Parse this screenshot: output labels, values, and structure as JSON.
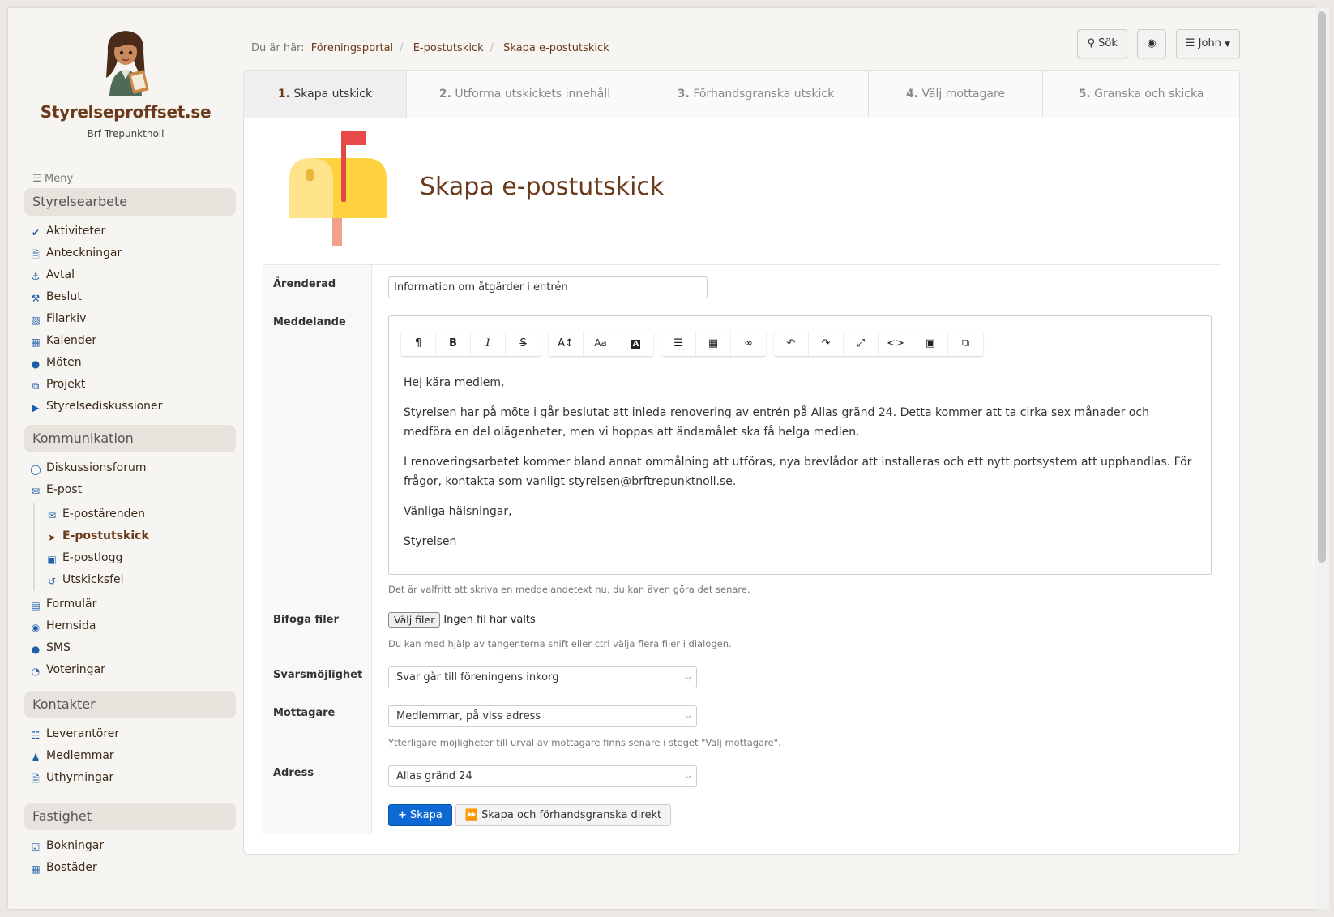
{
  "brand": {
    "name": "Styrelseproffset.se",
    "org": "Brf Trepunktnoll"
  },
  "menu_label": "Meny",
  "sections": [
    {
      "title": "Styrelsearbete",
      "items": [
        {
          "label": "Aktiviteter",
          "icon": "check-icon"
        },
        {
          "label": "Anteckningar",
          "icon": "document-icon"
        },
        {
          "label": "Avtal",
          "icon": "handshake-icon"
        },
        {
          "label": "Beslut",
          "icon": "gavel-icon"
        },
        {
          "label": "Filarkiv",
          "icon": "folder-icon"
        },
        {
          "label": "Kalender",
          "icon": "calendar-icon"
        },
        {
          "label": "Möten",
          "icon": "speech-bubble-icon"
        },
        {
          "label": "Projekt",
          "icon": "copy-icon"
        },
        {
          "label": "Styrelsediskussioner",
          "icon": "megaphone-icon"
        }
      ]
    },
    {
      "title": "Kommunikation",
      "items": [
        {
          "label": "Diskussionsforum",
          "icon": "comments-icon"
        },
        {
          "label": "E-post",
          "icon": "envelope-icon"
        },
        {
          "label": "Formulär",
          "icon": "list-icon"
        },
        {
          "label": "Hemsida",
          "icon": "globe-icon"
        },
        {
          "label": "SMS",
          "icon": "comment-icon"
        },
        {
          "label": "Voteringar",
          "icon": "pie-chart-icon"
        }
      ],
      "subitems": [
        {
          "label": "E-postärenden",
          "icon": "envelope-icon"
        },
        {
          "label": "E-postutskick",
          "icon": "paper-plane-icon"
        },
        {
          "label": "E-postlogg",
          "icon": "inbox-icon"
        },
        {
          "label": "Utskicksfel",
          "icon": "undo-icon"
        }
      ]
    },
    {
      "title": "Kontakter",
      "items": [
        {
          "label": "Leverantörer",
          "icon": "cart-icon"
        },
        {
          "label": "Medlemmar",
          "icon": "user-icon"
        },
        {
          "label": "Uthyrningar",
          "icon": "document-icon"
        }
      ]
    },
    {
      "title": "Fastighet",
      "items": [
        {
          "label": "Bokningar",
          "icon": "checkbox-icon"
        },
        {
          "label": "Bostäder",
          "icon": "building-icon"
        }
      ]
    }
  ],
  "breadcrumb": {
    "prefix": "Du är här:",
    "items": [
      "Föreningsportal",
      "E-postutskick",
      "Skapa e-postutskick"
    ]
  },
  "topbar": {
    "search_label": "Sök",
    "user_label": "John"
  },
  "steps": [
    {
      "num": "1.",
      "label": "Skapa utskick"
    },
    {
      "num": "2.",
      "label": "Utforma utskickets innehåll"
    },
    {
      "num": "3.",
      "label": "Förhandsgranska utskick"
    },
    {
      "num": "4.",
      "label": "Välj mottagare"
    },
    {
      "num": "5.",
      "label": "Granska och skicka"
    }
  ],
  "page_title": "Skapa e-postutskick",
  "form": {
    "subject_label": "Ärenderad",
    "subject_value": "Information om åtgärder i entrén",
    "message_label": "Meddelande",
    "message_paragraphs": [
      "Hej kära medlem,",
      "Styrelsen har på möte i går beslutat att inleda renovering av entrén på Allas gränd 24. Detta kommer att ta cirka sex månader och medföra en del olägenheter, men vi hoppas att ändamålet ska få helga medlen.",
      "I renoveringsarbetet kommer bland annat ommålning att utföras, nya brevlådor att installeras och ett nytt portsystem att upphandlas. För frågor, kontakta som vanligt styrelsen@brftrepunktnoll.se.",
      "Vänliga hälsningar,",
      "Styrelsen"
    ],
    "message_help": "Det är valfritt att skriva en meddelandetext nu, du kan även göra det senare.",
    "attach_label": "Bifoga filer",
    "file_button": "Välj filer",
    "file_status": "Ingen fil har valts",
    "attach_help": "Du kan med hjälp av tangenterna shift eller ctrl välja flera filer i dialogen.",
    "reply_label": "Svarsmöjlighet",
    "reply_value": "Svar går till föreningens inkorg",
    "recipients_label": "Mottagare",
    "recipients_value": "Medlemmar, på viss adress",
    "recipients_help": "Ytterligare möjligheter till urval av mottagare finns senare i steget \"Välj mottagare\".",
    "address_label": "Adress",
    "address_value": "Allas gränd 24",
    "create_button": "Skapa",
    "create_preview_button": "Skapa och förhandsgranska direkt"
  },
  "colors": {
    "brand": "#6b3a1c",
    "primary": "#0d6ad4",
    "icon": "#1f5fa8"
  }
}
